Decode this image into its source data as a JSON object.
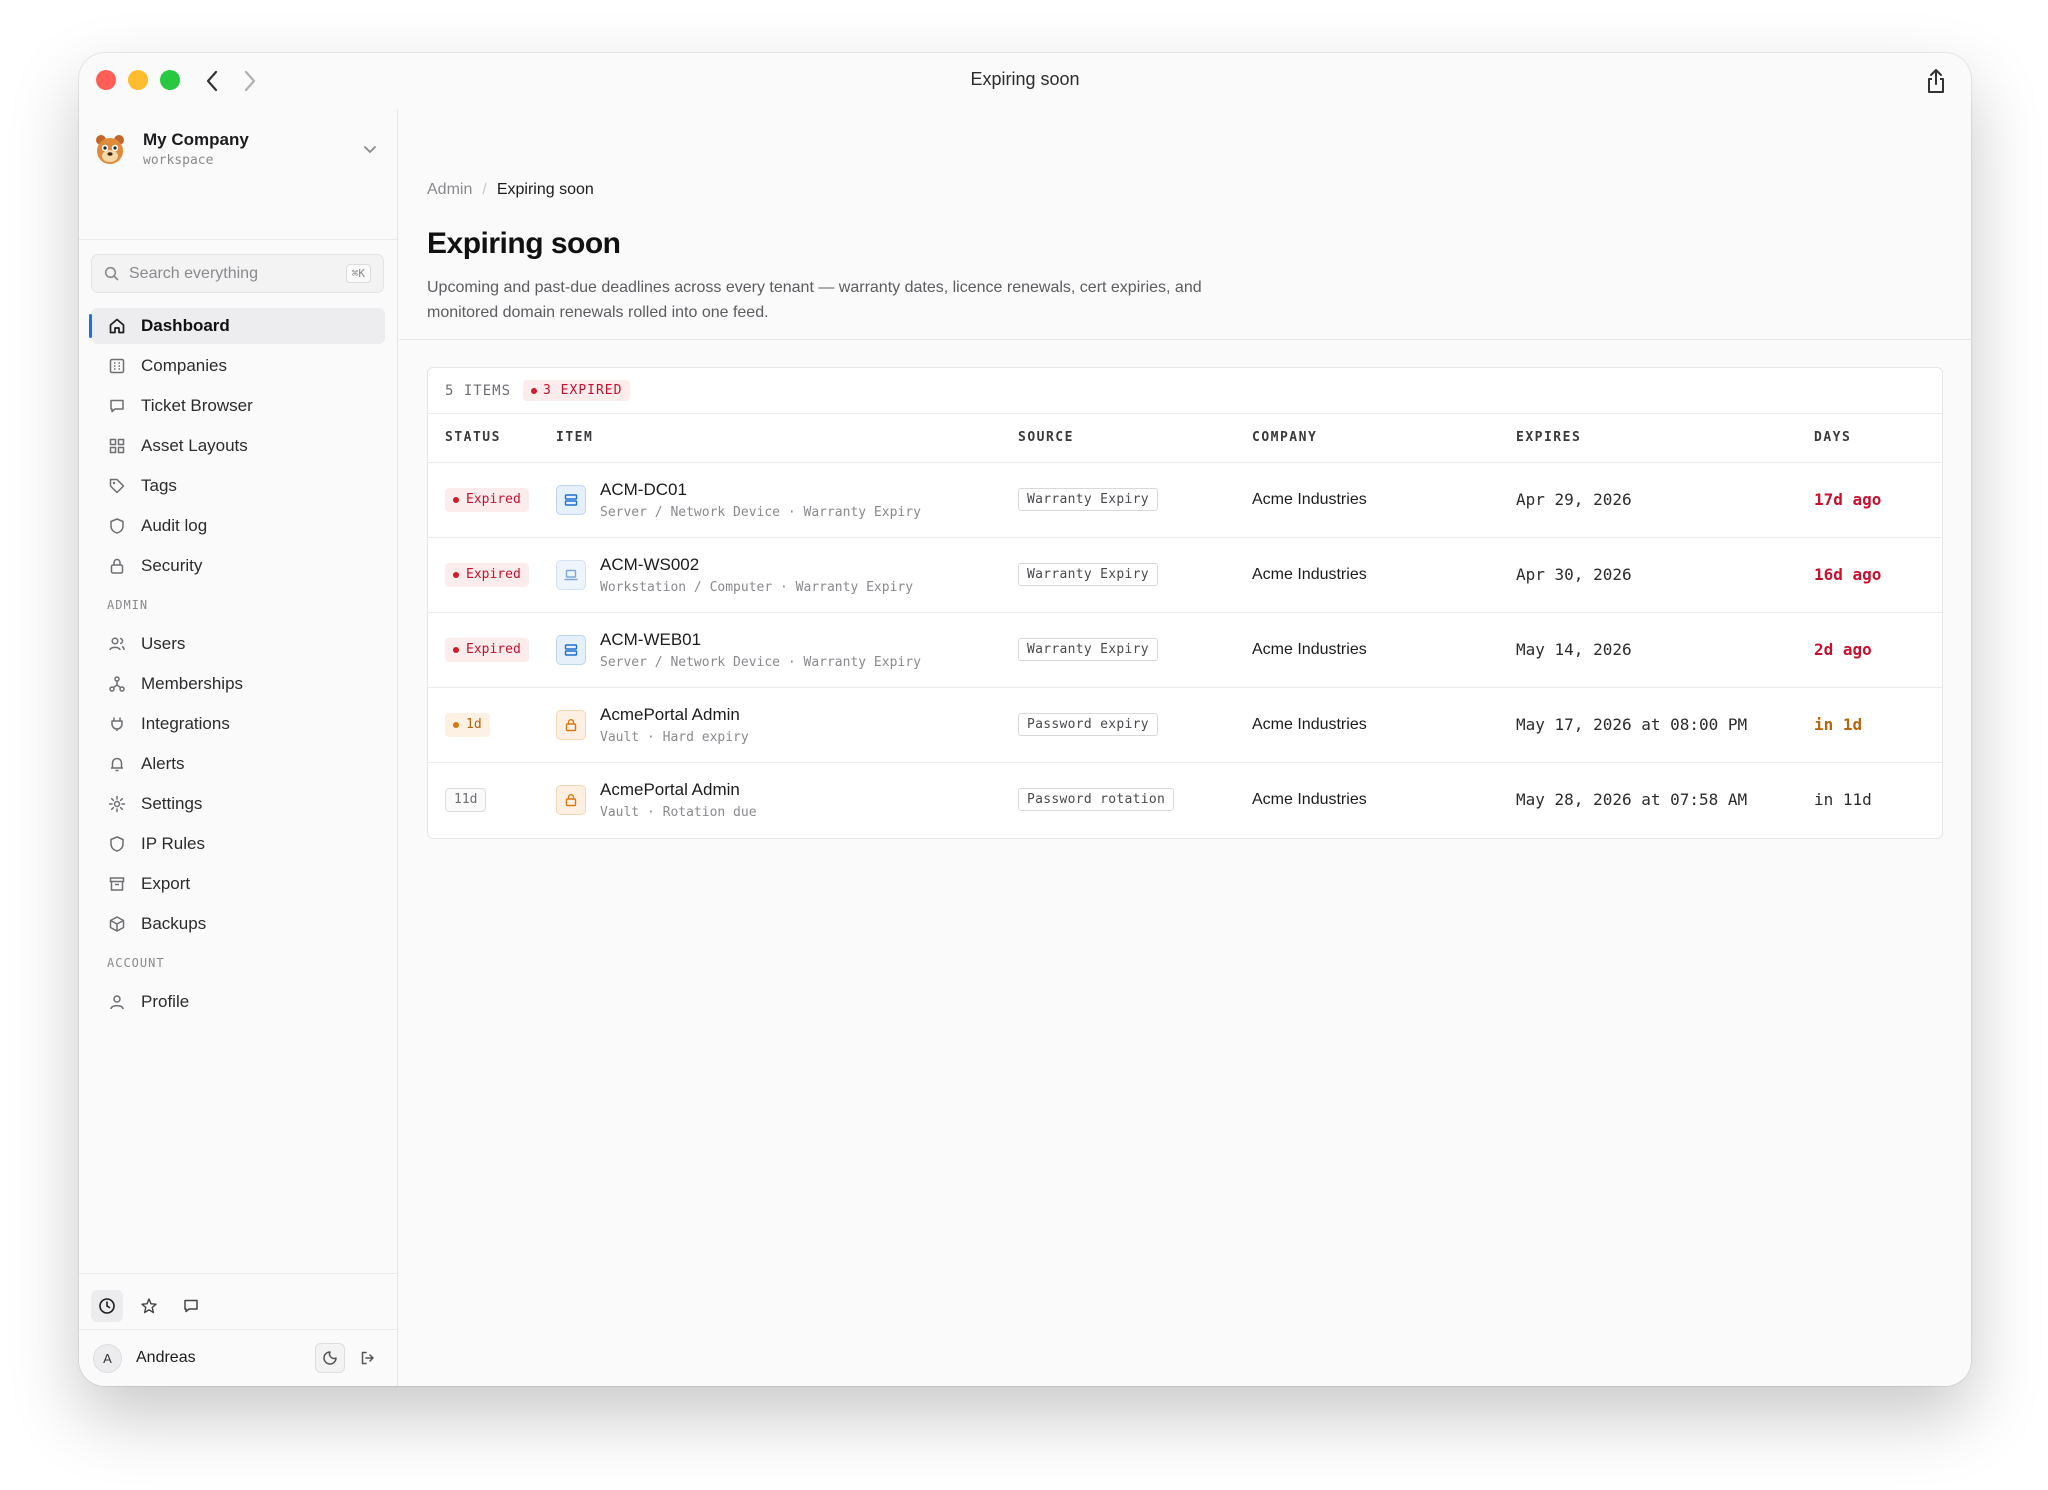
{
  "window": {
    "title": "Expiring soon"
  },
  "workspace": {
    "name": "My Company",
    "subtitle": "workspace"
  },
  "search": {
    "placeholder": "Search everything",
    "shortcut": "⌘K"
  },
  "nav": {
    "main": [
      {
        "label": "Dashboard",
        "icon": "home-icon"
      },
      {
        "label": "Companies",
        "icon": "building-icon"
      },
      {
        "label": "Ticket Browser",
        "icon": "message-icon"
      },
      {
        "label": "Asset Layouts",
        "icon": "grid-icon"
      },
      {
        "label": "Tags",
        "icon": "tag-icon"
      },
      {
        "label": "Audit log",
        "icon": "shield-icon"
      },
      {
        "label": "Security",
        "icon": "lock-icon"
      }
    ],
    "admin_heading": "ADMIN",
    "admin": [
      {
        "label": "Users",
        "icon": "users-icon"
      },
      {
        "label": "Memberships",
        "icon": "network-icon"
      },
      {
        "label": "Integrations",
        "icon": "plug-icon"
      },
      {
        "label": "Alerts",
        "icon": "bell-icon"
      },
      {
        "label": "Settings",
        "icon": "gear-icon"
      },
      {
        "label": "IP Rules",
        "icon": "shield-icon"
      },
      {
        "label": "Export",
        "icon": "archive-icon"
      },
      {
        "label": "Backups",
        "icon": "box-icon"
      }
    ],
    "account_heading": "ACCOUNT",
    "account": [
      {
        "label": "Profile",
        "icon": "user-icon"
      }
    ]
  },
  "user": {
    "initial": "A",
    "name": "Andreas"
  },
  "breadcrumb": {
    "parent": "Admin",
    "separator": "/",
    "current": "Expiring soon"
  },
  "page": {
    "title": "Expiring soon",
    "description": "Upcoming and past-due deadlines across every tenant — warranty dates, licence renewals, cert expiries, and monitored domain renewals rolled into one feed."
  },
  "summary": {
    "count": "5 ITEMS",
    "expired": "3 EXPIRED"
  },
  "table": {
    "columns": [
      "STATUS",
      "ITEM",
      "SOURCE",
      "COMPANY",
      "EXPIRES",
      "DAYS"
    ],
    "rows": [
      {
        "status": "Expired",
        "status_kind": "expired",
        "icon": "server-icon",
        "name": "ACM-DC01",
        "meta": "Server / Network Device · Warranty Expiry",
        "source": "Warranty Expiry",
        "company": "Acme Industries",
        "expires": "Apr 29, 2026",
        "days": "17d ago"
      },
      {
        "status": "Expired",
        "status_kind": "expired",
        "icon": "laptop-icon",
        "name": "ACM-WS002",
        "meta": "Workstation / Computer · Warranty Expiry",
        "source": "Warranty Expiry",
        "company": "Acme Industries",
        "expires": "Apr 30, 2026",
        "days": "16d ago"
      },
      {
        "status": "Expired",
        "status_kind": "expired",
        "icon": "server-icon",
        "name": "ACM-WEB01",
        "meta": "Server / Network Device · Warranty Expiry",
        "source": "Warranty Expiry",
        "company": "Acme Industries",
        "expires": "May 14, 2026",
        "days": "2d ago"
      },
      {
        "status": "1d",
        "status_kind": "soon",
        "icon": "lock-icon",
        "name": "AcmePortal Admin",
        "meta": "Vault · Hard expiry",
        "source": "Password expiry",
        "company": "Acme Industries",
        "expires": "May 17, 2026 at 08:00 PM",
        "days": "in 1d"
      },
      {
        "status": "11d",
        "status_kind": "ok",
        "icon": "lock-icon",
        "name": "AcmePortal Admin",
        "meta": "Vault · Rotation due",
        "source": "Password rotation",
        "company": "Acme Industries",
        "expires": "May 28, 2026 at 07:58 AM",
        "days": "in 11d"
      }
    ]
  }
}
